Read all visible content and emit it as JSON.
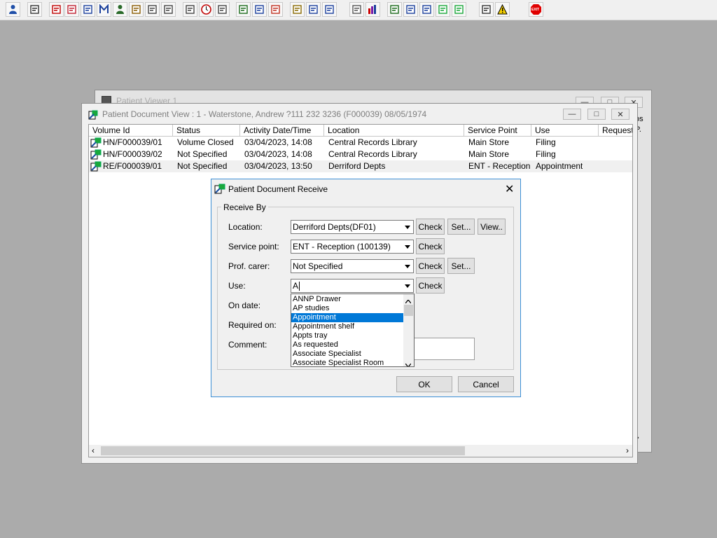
{
  "colors": {
    "desktop": "#ababab",
    "selection": "#0078d7",
    "dialog_border": "#3c8fd6",
    "exit_icon": "#e00000"
  },
  "toolbar": {
    "icons": [
      "user-icon",
      "printer-icon",
      "book-icon",
      "folder-edit-icon",
      "notes-icon",
      "m-letter-icon",
      "doctor-icon",
      "form-icon",
      "label-icon",
      "label-icon",
      "case-icon",
      "clock-icon",
      "screen-icon",
      "document-icon",
      "document-icon",
      "globe-icon",
      "list-icon",
      "tray-icon",
      "transfer-icon",
      "page-icon",
      "bar-chart-icon",
      "globe-icon",
      "form-icon",
      "form-icon",
      "green-flag-icon",
      "green-flag-icon",
      "swap-icon",
      "warning-icon",
      "exit-icon"
    ],
    "exit_label": "EXIT"
  },
  "bg_window": {
    "title": "Patient Viewer 1"
  },
  "main_window": {
    "title": "Patient Document View : 1 - Waterstone, Andrew ?111 232 3236 (F000039) 08/05/1974",
    "columns": [
      "Volume Id",
      "Status",
      "Activity Date/Time",
      "Location",
      "Service Point",
      "Use",
      "Requeste"
    ],
    "rows": [
      [
        "HN/F000039/01",
        "Volume Closed",
        "03/04/2023, 14:08",
        "Central Records Library",
        "Main Store",
        "Filing"
      ],
      [
        "HN/F000039/02",
        "Not Specified",
        "03/04/2023, 14:08",
        "Central Records Library",
        "Main Store",
        "Filing"
      ],
      [
        "RE/F000039/01",
        "Not Specified",
        "03/04/2023, 13:50",
        "Derriford Depts",
        "ENT - Reception",
        "Appointment"
      ]
    ]
  },
  "dialog": {
    "title": "Patient Document Receive",
    "group_label": "Receive By",
    "fields": {
      "location": {
        "label": "Location:",
        "value": "Derriford Depts(DF01)"
      },
      "service_point": {
        "label": "Service point:",
        "value": "ENT - Reception (100139)"
      },
      "prof_carer": {
        "label": "Prof. carer:",
        "value": "Not Specified"
      },
      "use": {
        "label": "Use:",
        "value": "A"
      },
      "on_date": {
        "label": "On date:"
      },
      "required_on": {
        "label": "Required on:"
      },
      "comment": {
        "label": "Comment:"
      }
    },
    "buttons": {
      "check": "Check",
      "set": "Set...",
      "view": "View..",
      "ok": "OK",
      "cancel": "Cancel"
    },
    "dropdown": {
      "options": [
        "ANNP Drawer",
        "AP studies",
        "Appointment",
        "Appointment shelf",
        "Appts tray",
        "As requested",
        "Associate Specialist",
        "Associate Specialist Room"
      ],
      "selected": "Appointment"
    }
  }
}
